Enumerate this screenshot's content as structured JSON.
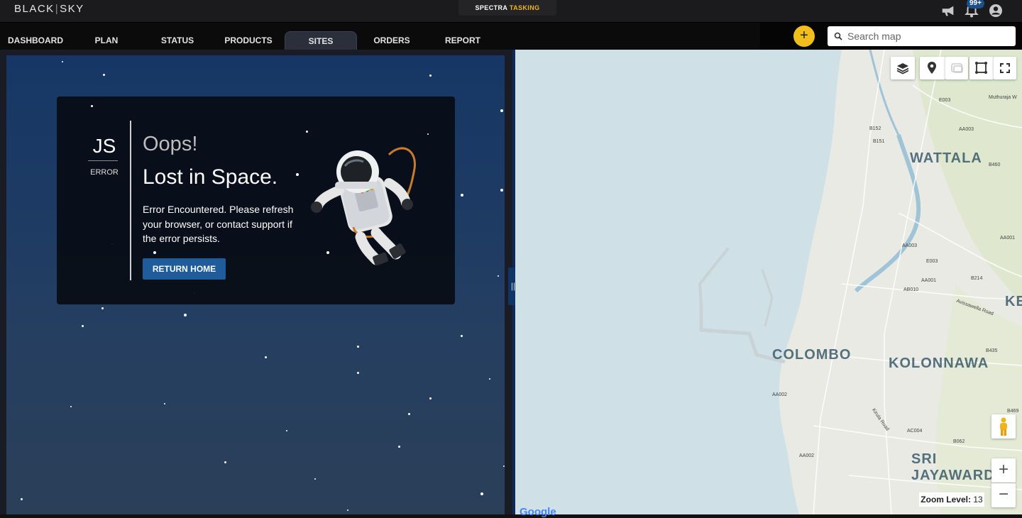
{
  "header": {
    "logo_left": "BLACK",
    "logo_sep": "|",
    "logo_right": "SKY",
    "product_prefix": "SPECTRA",
    "product_suffix": "TASKING",
    "notification_count": "99+",
    "icons": [
      "megaphone-icon",
      "bell-icon",
      "user-avatar-icon"
    ]
  },
  "nav": {
    "tabs": [
      {
        "label": "DASHBOARD",
        "active": false
      },
      {
        "label": "PLAN",
        "active": false
      },
      {
        "label": "STATUS",
        "active": false
      },
      {
        "label": "PRODUCTS",
        "active": false
      },
      {
        "label": "SITES",
        "active": true
      },
      {
        "label": "ORDERS",
        "active": false
      },
      {
        "label": "REPORT",
        "active": false
      }
    ]
  },
  "toolbar": {
    "add_label": "+",
    "search_placeholder": "Search map"
  },
  "error": {
    "code": "JS",
    "code_label": "ERROR",
    "title": "Oops!",
    "subtitle": "Lost in Space.",
    "message": "Error Encountered. Please refresh your browser, or contact support if the error persists.",
    "button": "RETURN HOME"
  },
  "splitter": {
    "handle": "||"
  },
  "map": {
    "labels": [
      "WATTALA",
      "COLOMBO",
      "KOLONNAWA",
      "SRI JAYAWARD",
      "KE"
    ],
    "roads": [
      "E003",
      "B152",
      "AA003",
      "B151",
      "B460",
      "AA003",
      "AA001",
      "E003",
      "AA001",
      "B214",
      "AB010",
      "B435",
      "AA002",
      "B469",
      "AC004",
      "B062",
      "AA002",
      "Kirula Road",
      "Avissawella Road",
      "Muthuraja W"
    ],
    "zoom_label": "Zoom Level:",
    "zoom_value": "13",
    "zoom_in": "+",
    "zoom_out": "−",
    "attribution": "Google",
    "controls": [
      "layers-icon",
      "pin-icon",
      "imagery-icon",
      "draw-area-icon",
      "fullscreen-icon"
    ]
  }
}
